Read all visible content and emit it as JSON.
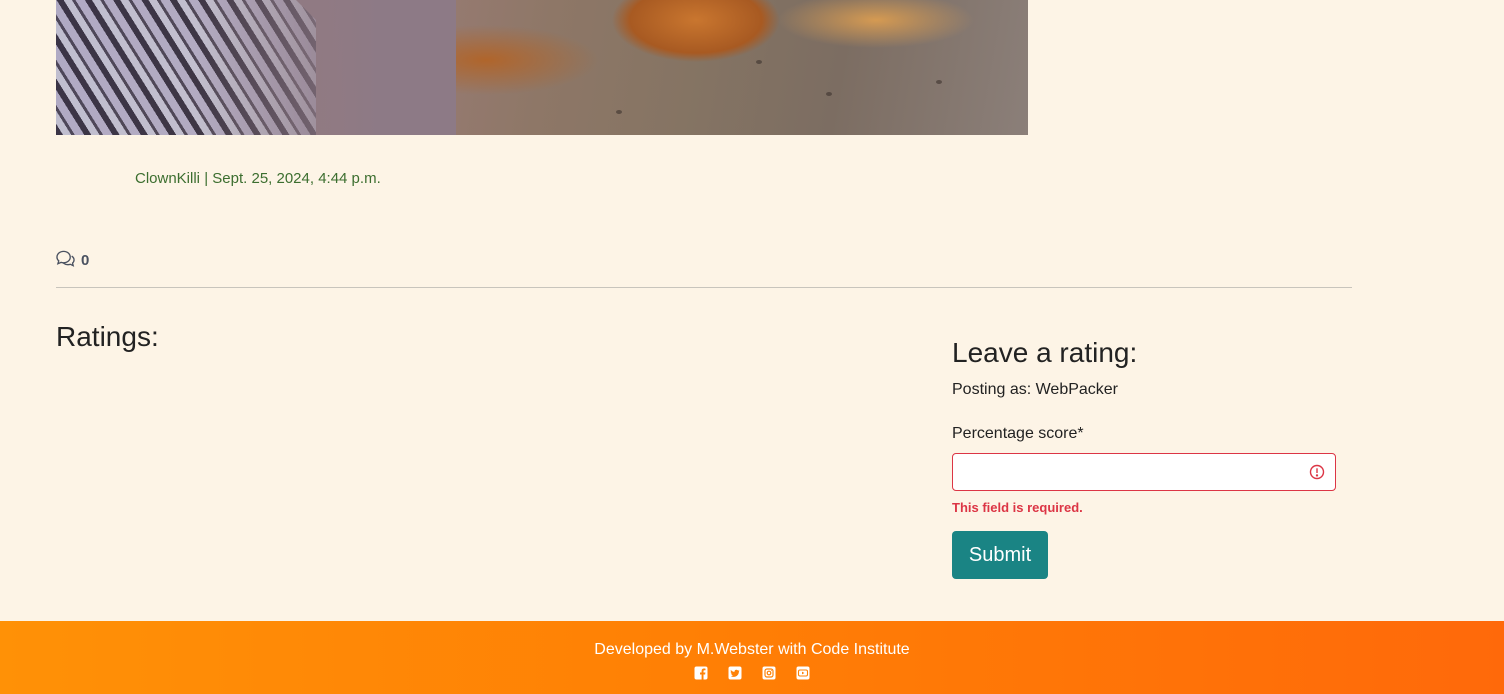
{
  "post": {
    "author": "ClownKilli",
    "separator": "|",
    "date": "Sept. 25, 2024, 4:44 p.m.",
    "comment_count": "0"
  },
  "ratings": {
    "title": "Ratings:"
  },
  "rating_form": {
    "title": "Leave a rating:",
    "posting_as": "Posting as: WebPacker",
    "score_label": "Percentage score*",
    "score_value": "",
    "error": "This field is required.",
    "submit_label": "Submit"
  },
  "footer": {
    "credit": "Developed by M.Webster with Code Institute",
    "social_icons": [
      "facebook-icon",
      "twitter-icon",
      "instagram-icon",
      "youtube-icon"
    ]
  },
  "colors": {
    "background": "#fdf4e6",
    "accent": "#1a8484",
    "meta_text": "#3c6e2f",
    "error": "#dc3545",
    "footer_start": "#ff9106",
    "footer_end": "#ff690a"
  }
}
